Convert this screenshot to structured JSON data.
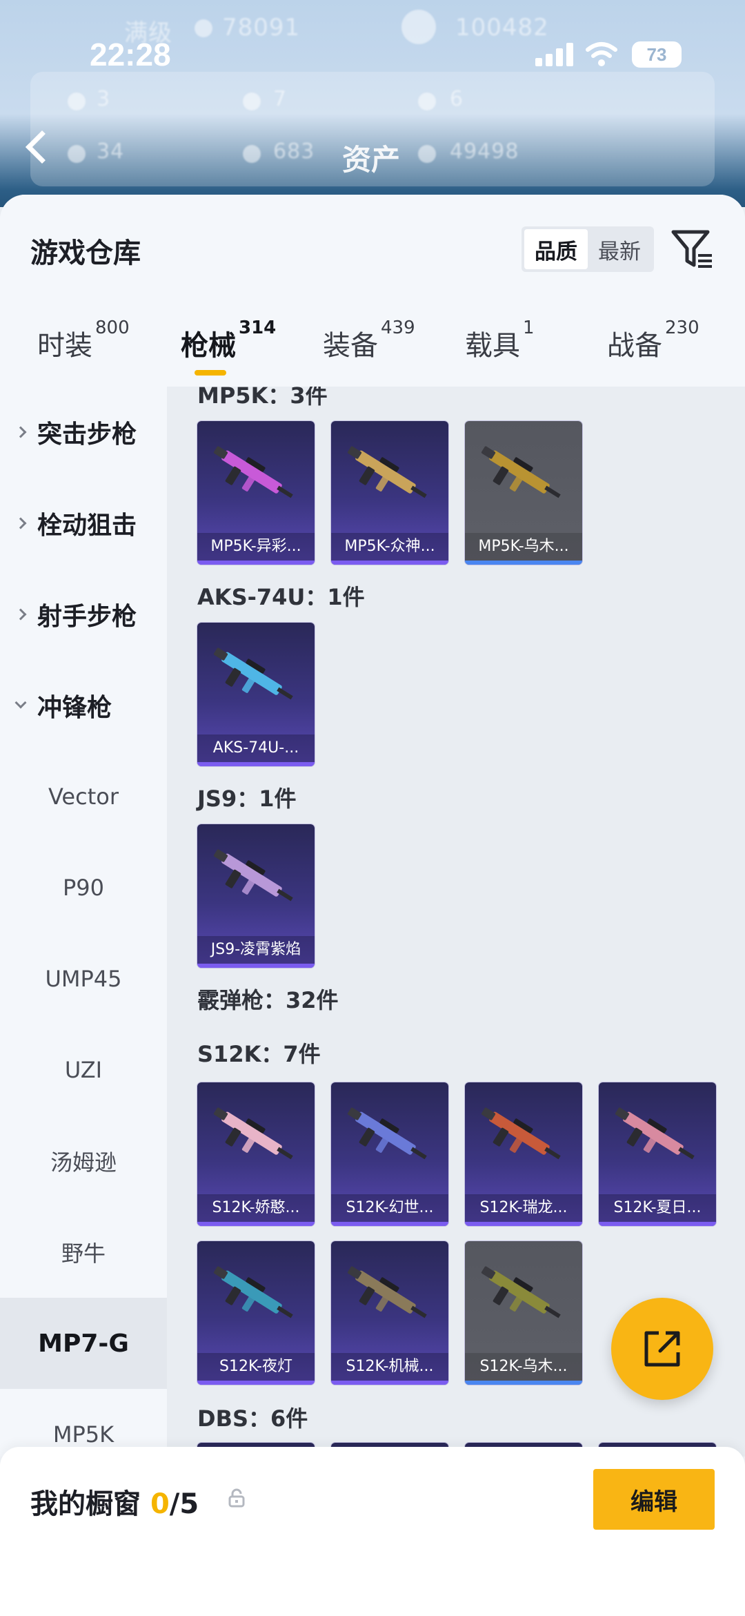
{
  "status_bar": {
    "time": "22:28",
    "battery": "73"
  },
  "backdrop": {
    "ghost_texts": [
      "满级",
      "78091",
      "100482",
      "3",
      "7",
      "6",
      "34",
      "683",
      "49498"
    ],
    "title": "资产"
  },
  "header": {
    "title": "游戏仓库",
    "sort_options": [
      "品质",
      "最新"
    ],
    "active_sort": "品质"
  },
  "tabs": [
    {
      "label": "时装",
      "count": "800"
    },
    {
      "label": "枪械",
      "count": "314"
    },
    {
      "label": "装备",
      "count": "439"
    },
    {
      "label": "载具",
      "count": "1"
    },
    {
      "label": "战备",
      "count": "230"
    }
  ],
  "active_tab": "枪械",
  "sidebar": {
    "categories": [
      {
        "label": "突击步枪",
        "expanded": false
      },
      {
        "label": "栓动狙击",
        "expanded": false
      },
      {
        "label": "射手步枪",
        "expanded": false
      },
      {
        "label": "冲锋枪",
        "expanded": true
      }
    ],
    "subcategories": [
      "Vector",
      "P90",
      "UMP45",
      "UZI",
      "汤姆逊",
      "野牛",
      "MP7-G",
      "MP5K"
    ],
    "selected": "MP7-G"
  },
  "groups": {
    "mp5k": {
      "title": "MP5K：3件",
      "items": [
        {
          "name": "MP5K-异彩...",
          "quality": "purple",
          "color": "#c85ad8"
        },
        {
          "name": "MP5K-众神...",
          "quality": "purple",
          "color": "#c9a45a"
        },
        {
          "name": "MP5K-乌木...",
          "quality": "blue",
          "color": "#b99332"
        }
      ]
    },
    "aks74u": {
      "title": "AKS-74U：1件",
      "items": [
        {
          "name": "AKS-74U-...",
          "quality": "purple",
          "color": "#4fb6e6"
        }
      ]
    },
    "js9": {
      "title": "JS9：1件",
      "items": [
        {
          "name": "JS9-凌霄紫焰",
          "quality": "purple",
          "color": "#b898d8"
        }
      ]
    },
    "shotgun": {
      "title": "霰弹枪：32件"
    },
    "s12k": {
      "title": "S12K：7件",
      "items": [
        {
          "name": "S12K-娇憨...",
          "quality": "purple",
          "color": "#e8b4c8"
        },
        {
          "name": "S12K-幻世...",
          "quality": "purple",
          "color": "#6a7ad8"
        },
        {
          "name": "S12K-瑞龙...",
          "quality": "purple",
          "color": "#c85a3a"
        },
        {
          "name": "S12K-夏日...",
          "quality": "purple",
          "color": "#d88aa0"
        },
        {
          "name": "S12K-夜灯",
          "quality": "purple",
          "color": "#3a9ab8"
        },
        {
          "name": "S12K-机械...",
          "quality": "purple",
          "color": "#8a7a5a"
        },
        {
          "name": "S12K-乌木...",
          "quality": "blue",
          "color": "#8a8a3a"
        }
      ]
    },
    "dbs": {
      "title": "DBS：6件"
    }
  },
  "showcase": {
    "label": "我的橱窗",
    "current": "0",
    "total": "/5"
  },
  "edit_label": "编辑"
}
